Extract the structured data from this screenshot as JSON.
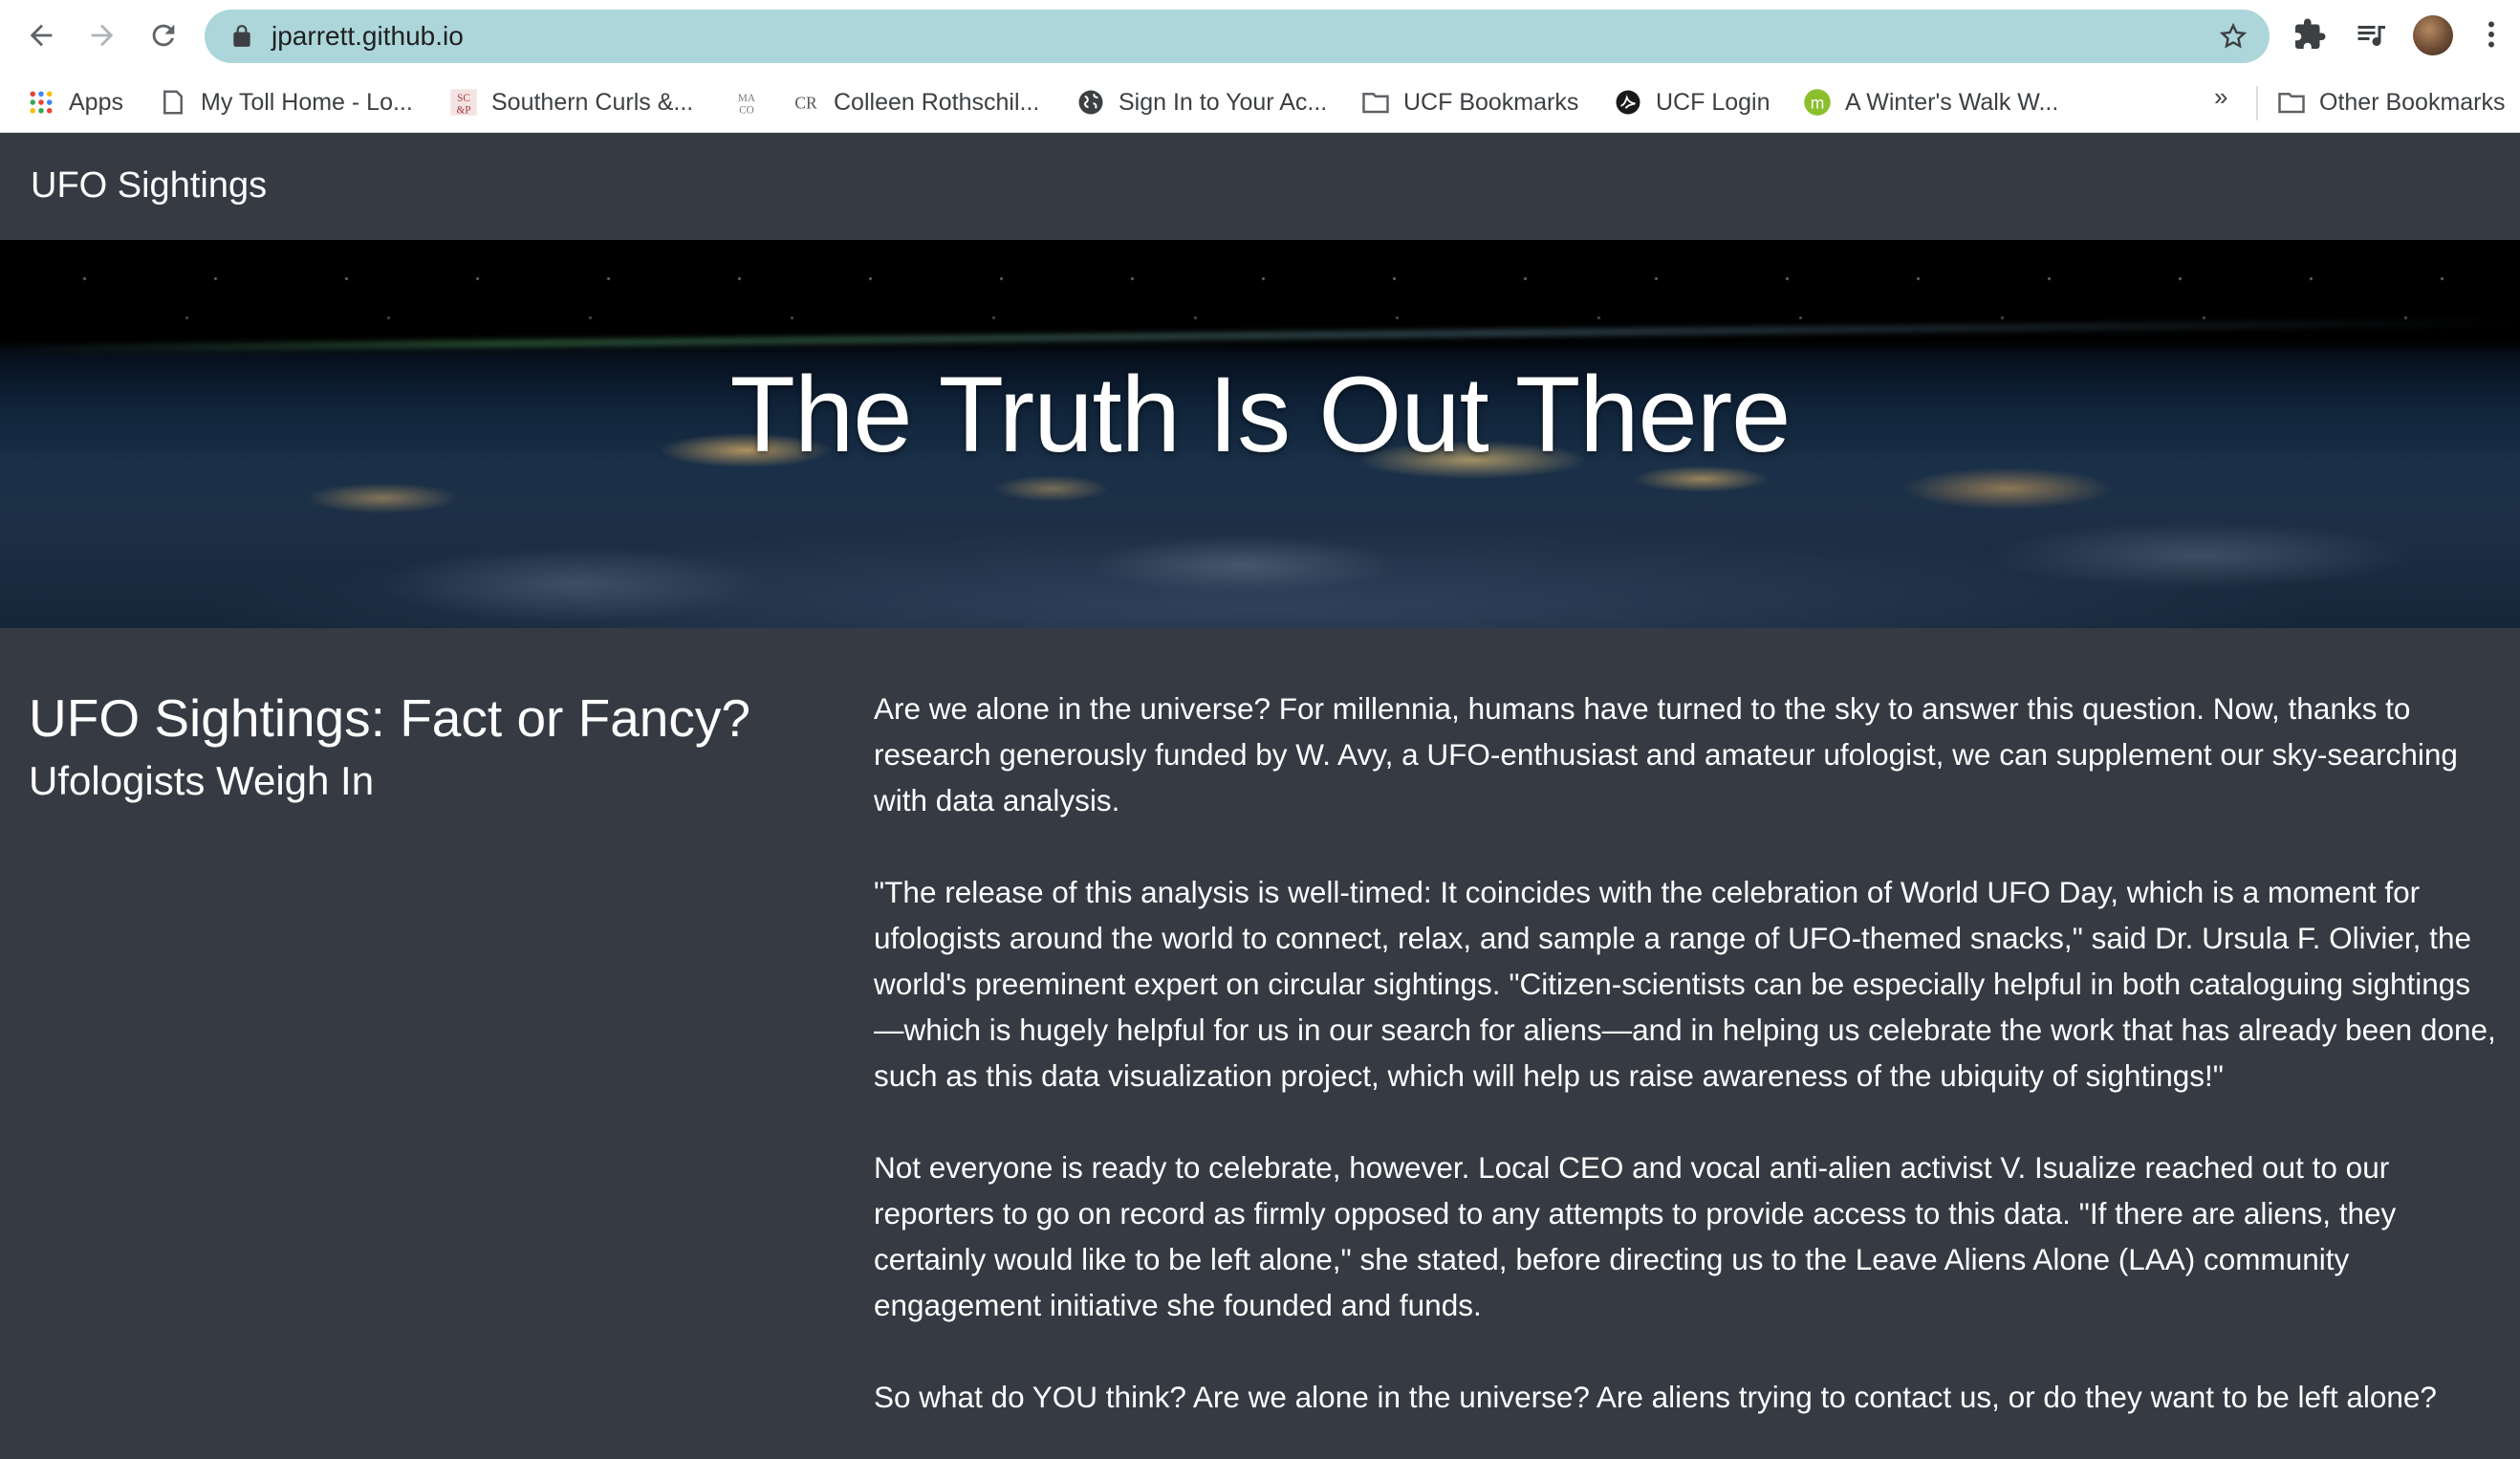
{
  "browser": {
    "url": "jparrett.github.io",
    "bookmarks": [
      {
        "label": "Apps",
        "icon": "apps-grid-icon"
      },
      {
        "label": "My Toll Home - Lo...",
        "icon": "page-icon"
      },
      {
        "label": "Southern Curls &...",
        "icon": "favicon-sc"
      },
      {
        "label": "",
        "icon": "favicon-mco"
      },
      {
        "label": "Colleen Rothschil...",
        "icon": "favicon-cr"
      },
      {
        "label": "Sign In to Your Ac...",
        "icon": "globe-icon"
      },
      {
        "label": "UCF Bookmarks",
        "icon": "folder-icon"
      },
      {
        "label": "UCF Login",
        "icon": "ucf-pegasus-icon"
      },
      {
        "label": "A Winter's Walk W...",
        "icon": "favicon-m"
      }
    ],
    "more_chevron": "»",
    "other_bookmarks": "Other Bookmarks"
  },
  "page": {
    "brand": "UFO Sightings",
    "hero_title": "The Truth Is Out There",
    "heading": "UFO Sightings: Fact or Fancy?",
    "subheading": "Ufologists Weigh In",
    "paragraphs": [
      "Are we alone in the universe? For millennia, humans have turned to the sky to answer this question. Now, thanks to research generously funded by W. Avy, a UFO-enthusiast and amateur ufologist, we can supplement our sky-searching with data analysis.",
      "\"The release of this analysis is well-timed: It coincides with the celebration of World UFO Day, which is a moment for ufologists around the world to connect, relax, and sample a range of UFO-themed snacks,\" said Dr. Ursula F. Olivier, the world's preeminent expert on circular sightings. \"Citizen-scientists can be especially helpful in both cataloguing sightings—which is hugely helpful for us in our search for aliens—and in helping us celebrate the work that has already been done, such as this data visualization project, which will help us raise awareness of the ubiquity of sightings!\"",
      "Not everyone is ready to celebrate, however. Local CEO and vocal anti-alien activist V. Isualize reached out to our reporters to go on record as firmly opposed to any attempts to provide access to this data. \"If there are aliens, they certainly would like to be left alone,\" she stated, before directing us to the Leave Aliens Alone (LAA) community engagement initiative she founded and funds.",
      "So what do YOU think? Are we alone in the universe? Are aliens trying to contact us, or do they want to be left alone?"
    ]
  },
  "colors": {
    "page_bg": "#363a42",
    "url_bar": "#acd6d9",
    "text": "#ffffff"
  }
}
